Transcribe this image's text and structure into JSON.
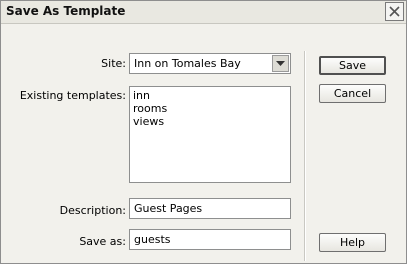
{
  "window": {
    "title": "Save As Template"
  },
  "site": {
    "label": "Site:",
    "value": "Inn on Tomales Bay"
  },
  "templates": {
    "label": "Existing templates:",
    "items": [
      "inn",
      "rooms",
      "views"
    ]
  },
  "description": {
    "label": "Description:",
    "value": "Guest Pages"
  },
  "save_as": {
    "label": "Save as:",
    "value": "guests"
  },
  "buttons": {
    "save": "Save",
    "cancel": "Cancel",
    "help": "Help"
  }
}
